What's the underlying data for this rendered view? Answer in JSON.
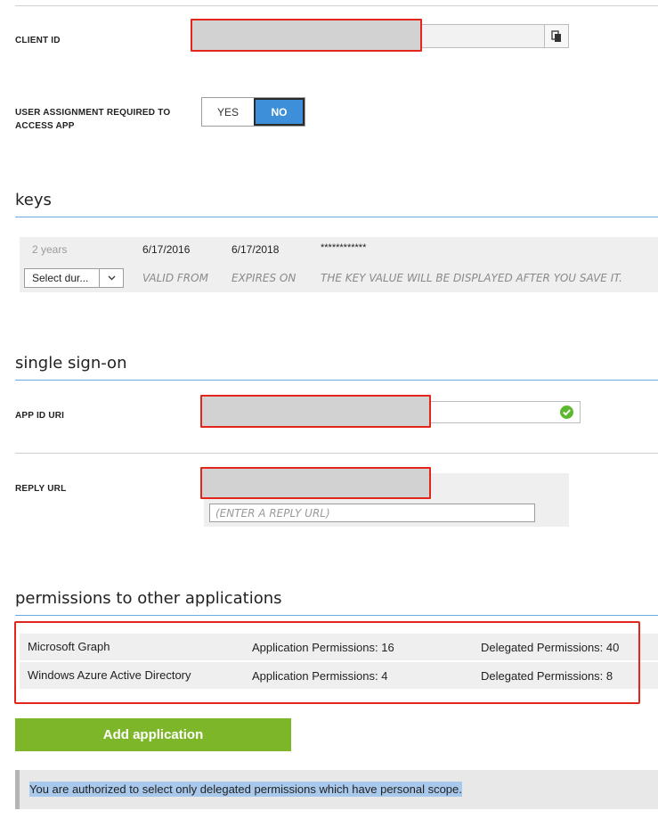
{
  "client_id": {
    "label": "CLIENT ID",
    "copy_icon": "copy-icon"
  },
  "user_assignment": {
    "label": "USER ASSIGNMENT REQUIRED TO ACCESS APP",
    "yes_label": "YES",
    "no_label": "NO",
    "selected": "NO",
    "active_color": "#3c8fd8"
  },
  "keys": {
    "title": "keys",
    "rows": [
      {
        "duration": "2 years",
        "valid_from": "6/17/2016",
        "expires_on": "6/17/2018",
        "value": "************"
      }
    ],
    "new_row": {
      "select_value": "Select dur...",
      "valid_from_hint": "VALID FROM",
      "expires_on_hint": "EXPIRES ON",
      "value_hint": "THE KEY VALUE WILL BE DISPLAYED AFTER YOU SAVE IT."
    }
  },
  "sso": {
    "title": "single sign-on",
    "app_id_uri_label": "APP ID URI",
    "reply_url_label": "REPLY URL",
    "reply_url_placeholder": "(ENTER A REPLY URL)",
    "valid_icon": "check-circle-icon",
    "valid_color": "#5cb82e"
  },
  "permissions": {
    "title": "permissions to other applications",
    "rows": [
      {
        "app": "Microsoft Graph",
        "application": "Application Permissions: 16",
        "delegated": "Delegated Permissions: 40"
      },
      {
        "app": "Windows Azure Active Directory",
        "application": "Application Permissions: 4",
        "delegated": "Delegated Permissions: 8"
      }
    ],
    "add_button": "Add application",
    "add_color": "#7db729"
  },
  "notice": {
    "text": "You are authorized to select only delegated permissions which have personal scope."
  },
  "colors": {
    "accent_blue": "#3c8fd8",
    "highlight": "#e2261b"
  }
}
